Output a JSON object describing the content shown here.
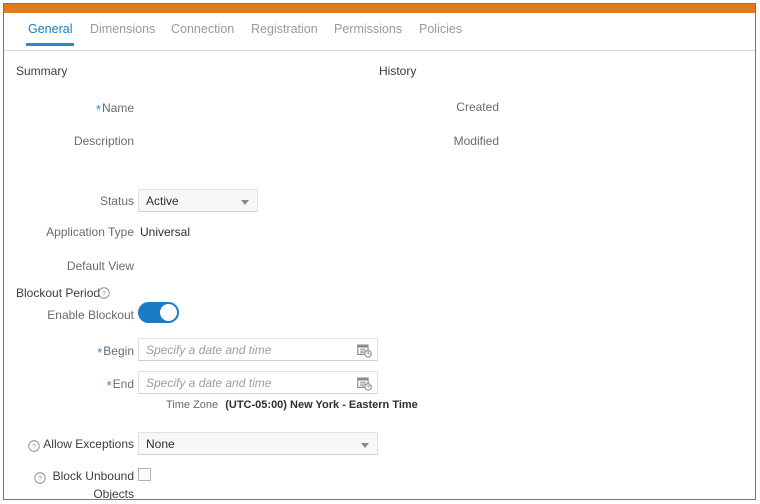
{
  "theme": {
    "accent_orange": "#e07b20",
    "active_blue": "#1a7bc4",
    "frame_blue": "#4a7ebb",
    "toggle_on": "#1a7bc4",
    "required_star": "#2a87d0"
  },
  "tabs": [
    {
      "label": "General",
      "active": true
    },
    {
      "label": "Dimensions",
      "active": false
    },
    {
      "label": "Connection",
      "active": false
    },
    {
      "label": "Registration",
      "active": false
    },
    {
      "label": "Permissions",
      "active": false
    },
    {
      "label": "Policies",
      "active": false
    }
  ],
  "sections": {
    "summary": {
      "heading": "Summary"
    },
    "history": {
      "heading": "History"
    },
    "blockout": {
      "heading": "Blockout Period",
      "help_icon": "help-circle-icon"
    }
  },
  "summary": {
    "name": {
      "label": "Name",
      "required": true,
      "value": ""
    },
    "description": {
      "label": "Description",
      "value": ""
    },
    "status": {
      "label": "Status",
      "value": "Active",
      "caret_icon": "chevron-down-icon"
    },
    "application_type": {
      "label": "Application Type",
      "value": "Universal"
    },
    "default_view": {
      "label": "Default View",
      "value": ""
    }
  },
  "history": {
    "created": {
      "label": "Created",
      "value": ""
    },
    "modified": {
      "label": "Modified",
      "value": ""
    }
  },
  "blockout": {
    "enable": {
      "label": "Enable Blockout",
      "on": true
    },
    "begin": {
      "label": "Begin",
      "required": true,
      "value": "",
      "placeholder": "Specify a date and time",
      "icon": "calendar-clock-icon"
    },
    "end": {
      "label": "End",
      "required": true,
      "value": "",
      "placeholder": "Specify a date and time",
      "icon": "calendar-clock-icon"
    },
    "time_zone": {
      "label": "Time Zone",
      "value": "(UTC-05:00) New York - Eastern Time"
    },
    "allow_exceptions": {
      "label": "Allow Exceptions",
      "value": "None",
      "help_icon": "help-circle-icon",
      "caret_icon": "chevron-down-icon"
    },
    "block_unbound": {
      "label_line1": "Block Unbound",
      "label_line2": "Objects",
      "checked": false,
      "help_icon": "help-circle-icon"
    }
  }
}
